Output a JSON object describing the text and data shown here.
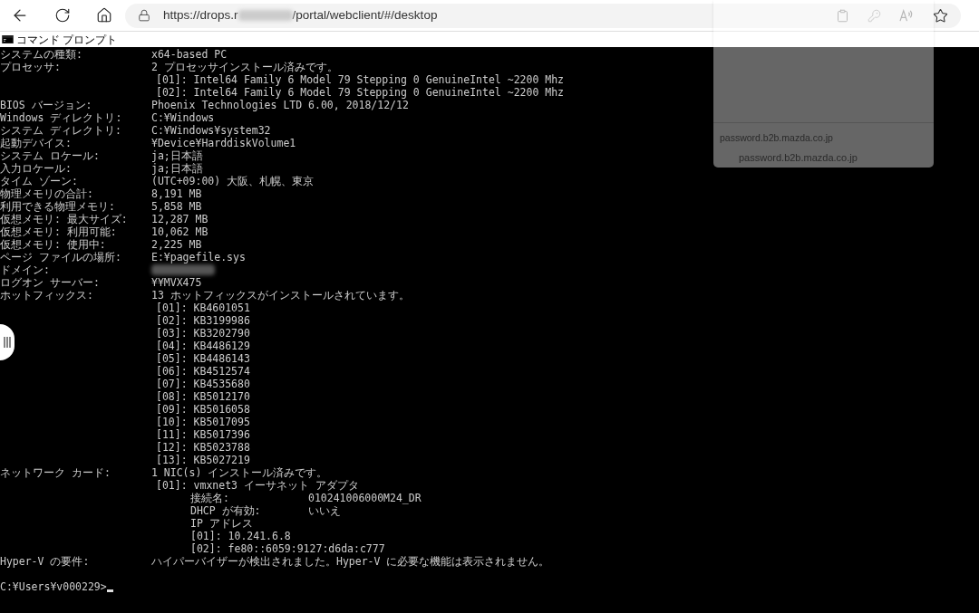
{
  "browser": {
    "url_start": "https://drops.r",
    "url_end": "/portal/webclient/#/desktop"
  },
  "window": {
    "title": "コマンド プロンプト"
  },
  "console": {
    "rows": [
      {
        "label": "システムの種類:",
        "value": "x64-based PC"
      },
      {
        "label": "プロセッサ:",
        "value": "2 プロセッサインストール済みです。",
        "children": [
          {
            "value": "[01]: Intel64 Family 6 Model 79 Stepping 0 GenuineIntel ~2200 Mhz"
          },
          {
            "value": "[02]: Intel64 Family 6 Model 79 Stepping 0 GenuineIntel ~2200 Mhz"
          }
        ]
      },
      {
        "label": "BIOS バージョン:",
        "value": "Phoenix Technologies LTD 6.00, 2018/12/12"
      },
      {
        "label": "Windows ディレクトリ:",
        "value": "C:¥Windows"
      },
      {
        "label": "システム ディレクトリ:",
        "value": "C:¥Windows¥system32"
      },
      {
        "label": "起動デバイス:",
        "value": "¥Device¥HarddiskVolume1"
      },
      {
        "label": "システム ロケール:",
        "value": "ja;日本語"
      },
      {
        "label": "入力ロケール:",
        "value": "ja;日本語"
      },
      {
        "label": "タイム ゾーン:",
        "value": "(UTC+09:00) 大阪、札幌、東京"
      },
      {
        "label": "物理メモリの合計:",
        "value": "8,191 MB"
      },
      {
        "label": "利用できる物理メモリ:",
        "value": "5,858 MB"
      },
      {
        "label": "仮想メモリ: 最大サイズ:",
        "value": "12,287 MB"
      },
      {
        "label": "仮想メモリ: 利用可能:",
        "value": "10,062 MB"
      },
      {
        "label": "仮想メモリ: 使用中:",
        "value": "2,225 MB"
      },
      {
        "label": "ページ ファイルの場所:",
        "value": "E:¥pagefile.sys"
      },
      {
        "label": "ドメイン:",
        "redacted": true
      },
      {
        "label": "ログオン サーバー:",
        "value": "¥¥MVX475"
      },
      {
        "label": "ホットフィックス:",
        "value": "13 ホットフィックスがインストールされています。",
        "children": [
          {
            "value": "[01]: KB4601051"
          },
          {
            "value": "[02]: KB3199986"
          },
          {
            "value": "[03]: KB3202790"
          },
          {
            "value": "[04]: KB4486129"
          },
          {
            "value": "[05]: KB4486143"
          },
          {
            "value": "[06]: KB4512574"
          },
          {
            "value": "[07]: KB4535680"
          },
          {
            "value": "[08]: KB5012170"
          },
          {
            "value": "[09]: KB5016058"
          },
          {
            "value": "[10]: KB5017095"
          },
          {
            "value": "[11]: KB5017396"
          },
          {
            "value": "[12]: KB5023788"
          },
          {
            "value": "[13]: KB5027219"
          }
        ]
      },
      {
        "label": "ネットワーク カード:",
        "value": "1 NIC(s) インストール済みです。",
        "children": [
          {
            "value": "[01]: vmxnet3 イーサネット アダプタ",
            "children": [
              {
                "label": "接続名:",
                "value": "010241006000M24_DR"
              },
              {
                "label": "DHCP が有効:",
                "value": "いいえ"
              },
              {
                "value": "IP アドレス"
              },
              {
                "value": "[01]: 10.241.6.8"
              },
              {
                "value": "[02]: fe80::6059:9127:d6da:c777"
              }
            ]
          }
        ]
      },
      {
        "label": "Hyper-V の要件:",
        "value": "ハイパーバイザーが検出されました。Hyper-V に必要な機能は表示されません。"
      }
    ],
    "prompt": "C:¥Users¥v000229>"
  },
  "popup": {
    "heading": "password.b2b.mazda.co.jp",
    "items": [
      "password.b2b.mazda.co.jp"
    ]
  }
}
